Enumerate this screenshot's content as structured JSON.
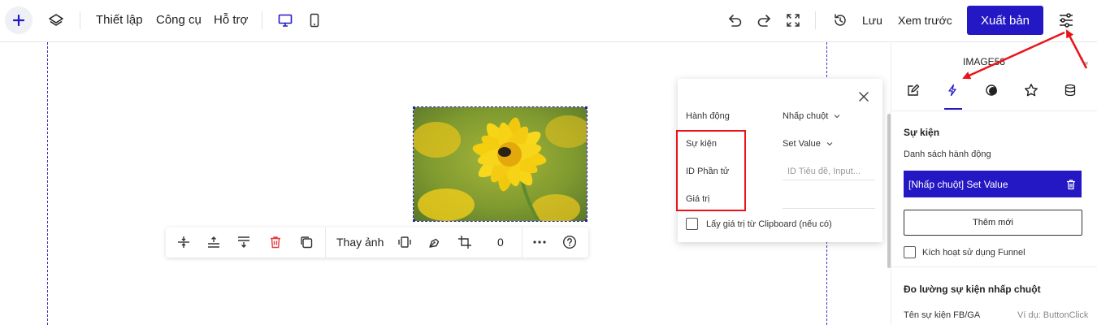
{
  "topbar": {
    "menu": [
      "Thiết lập",
      "Công cụ",
      "Hỗ trợ"
    ],
    "save_label": "Lưu",
    "preview_label": "Xem trước",
    "publish_label": "Xuất bản"
  },
  "toolbar": {
    "replace_image_label": "Thay ảnh",
    "counter_value": "0"
  },
  "popup": {
    "rows": [
      {
        "label": "Hành động",
        "value": "Nhấp chuột"
      },
      {
        "label": "Sự kiện",
        "value": "Set Value"
      },
      {
        "label": "ID Phần tử",
        "placeholder": "ID Tiêu đề, Input..."
      },
      {
        "label": "Giá trị",
        "value": ""
      }
    ],
    "clipboard_label": "Lấy giá trị từ Clipboard (nếu có)"
  },
  "panel": {
    "element_name": "IMAGE58",
    "section_title": "Sự kiện",
    "list_label": "Danh sách hành động",
    "action_item": "[Nhấp chuột] Set Value",
    "add_new_label": "Thêm mới",
    "funnel_label": "Kích hoạt sử dụng Funnel",
    "tracking_title": "Đo lường sự kiện nhấp chuột",
    "fb_event_label": "Tên sự kiện FB/GA",
    "fb_event_placeholder": "Ví dụ: ButtonClick"
  },
  "colors": {
    "brand": "#2418c4",
    "highlight_red": "#e8141a"
  },
  "icons": [
    "plus-icon",
    "layers-icon",
    "desktop-icon",
    "mobile-icon",
    "undo-icon",
    "redo-icon",
    "fullscreen-icon",
    "history-icon",
    "settings-sliders-icon",
    "edit-icon",
    "lightning-icon",
    "contrast-icon",
    "star-icon",
    "database-icon",
    "trash-icon",
    "close-icon",
    "chevron-down-icon"
  ]
}
